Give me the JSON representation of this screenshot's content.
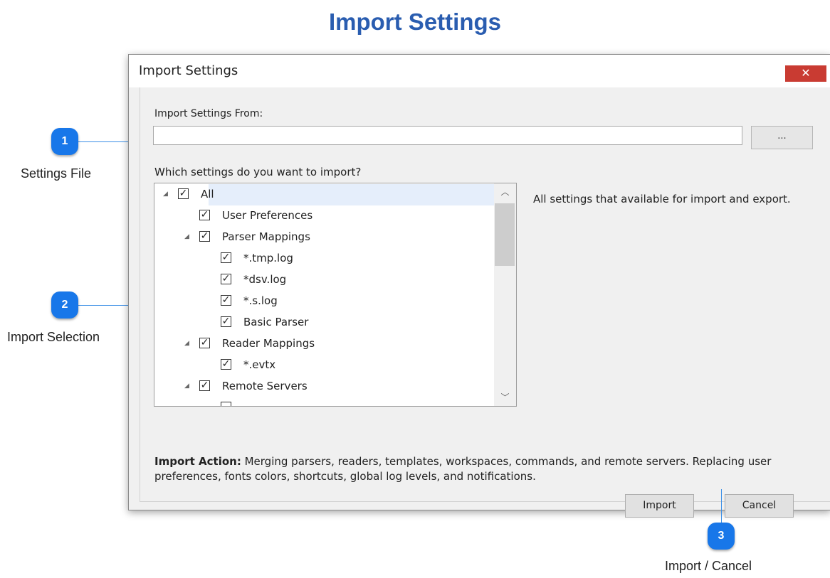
{
  "page": {
    "heading": "Import Settings"
  },
  "dialog": {
    "title": "Import Settings",
    "close_glyph": "✕",
    "import_from_label": "Import Settings From:",
    "path_value": "",
    "browse_label": "...",
    "which_label": "Which settings do you want to import?",
    "tree": [
      {
        "label": "All",
        "checked": true,
        "expanded": true,
        "level": 0,
        "selected": true
      },
      {
        "label": "User Preferences",
        "checked": true,
        "level": 1
      },
      {
        "label": "Parser Mappings",
        "checked": true,
        "expanded": true,
        "level": 1
      },
      {
        "label": "*.tmp.log",
        "checked": true,
        "level": 2
      },
      {
        "label": "*dsv.log",
        "checked": true,
        "level": 2
      },
      {
        "label": "*.s.log",
        "checked": true,
        "level": 2
      },
      {
        "label": "Basic Parser",
        "checked": true,
        "level": 2
      },
      {
        "label": "Reader Mappings",
        "checked": true,
        "expanded": true,
        "level": 1
      },
      {
        "label": "*.evtx",
        "checked": true,
        "level": 2
      },
      {
        "label": "Remote Servers",
        "checked": true,
        "expanded": true,
        "level": 1
      }
    ],
    "description": "All settings that available for import and export.",
    "action_bold": "Import Action:",
    "action_text": " Merging parsers, readers, templates, workspaces, commands, and remote servers. Replacing user preferences, fonts  colors, shortcuts, global log levels, and notifications.",
    "import_button": "Import",
    "cancel_button": "Cancel"
  },
  "callouts": [
    {
      "number": "1",
      "label": "Settings File"
    },
    {
      "number": "2",
      "label": "Import Selection"
    },
    {
      "number": "3",
      "label": "Import / Cancel"
    }
  ],
  "colors": {
    "heading": "#2a5db0",
    "badge": "#1877e9",
    "close": "#c93b32"
  },
  "icons": {
    "expander": "triangle-down-icon",
    "check": "checkmark-icon",
    "scroll_up": "chevron-up-icon",
    "scroll_down": "chevron-down-icon"
  }
}
